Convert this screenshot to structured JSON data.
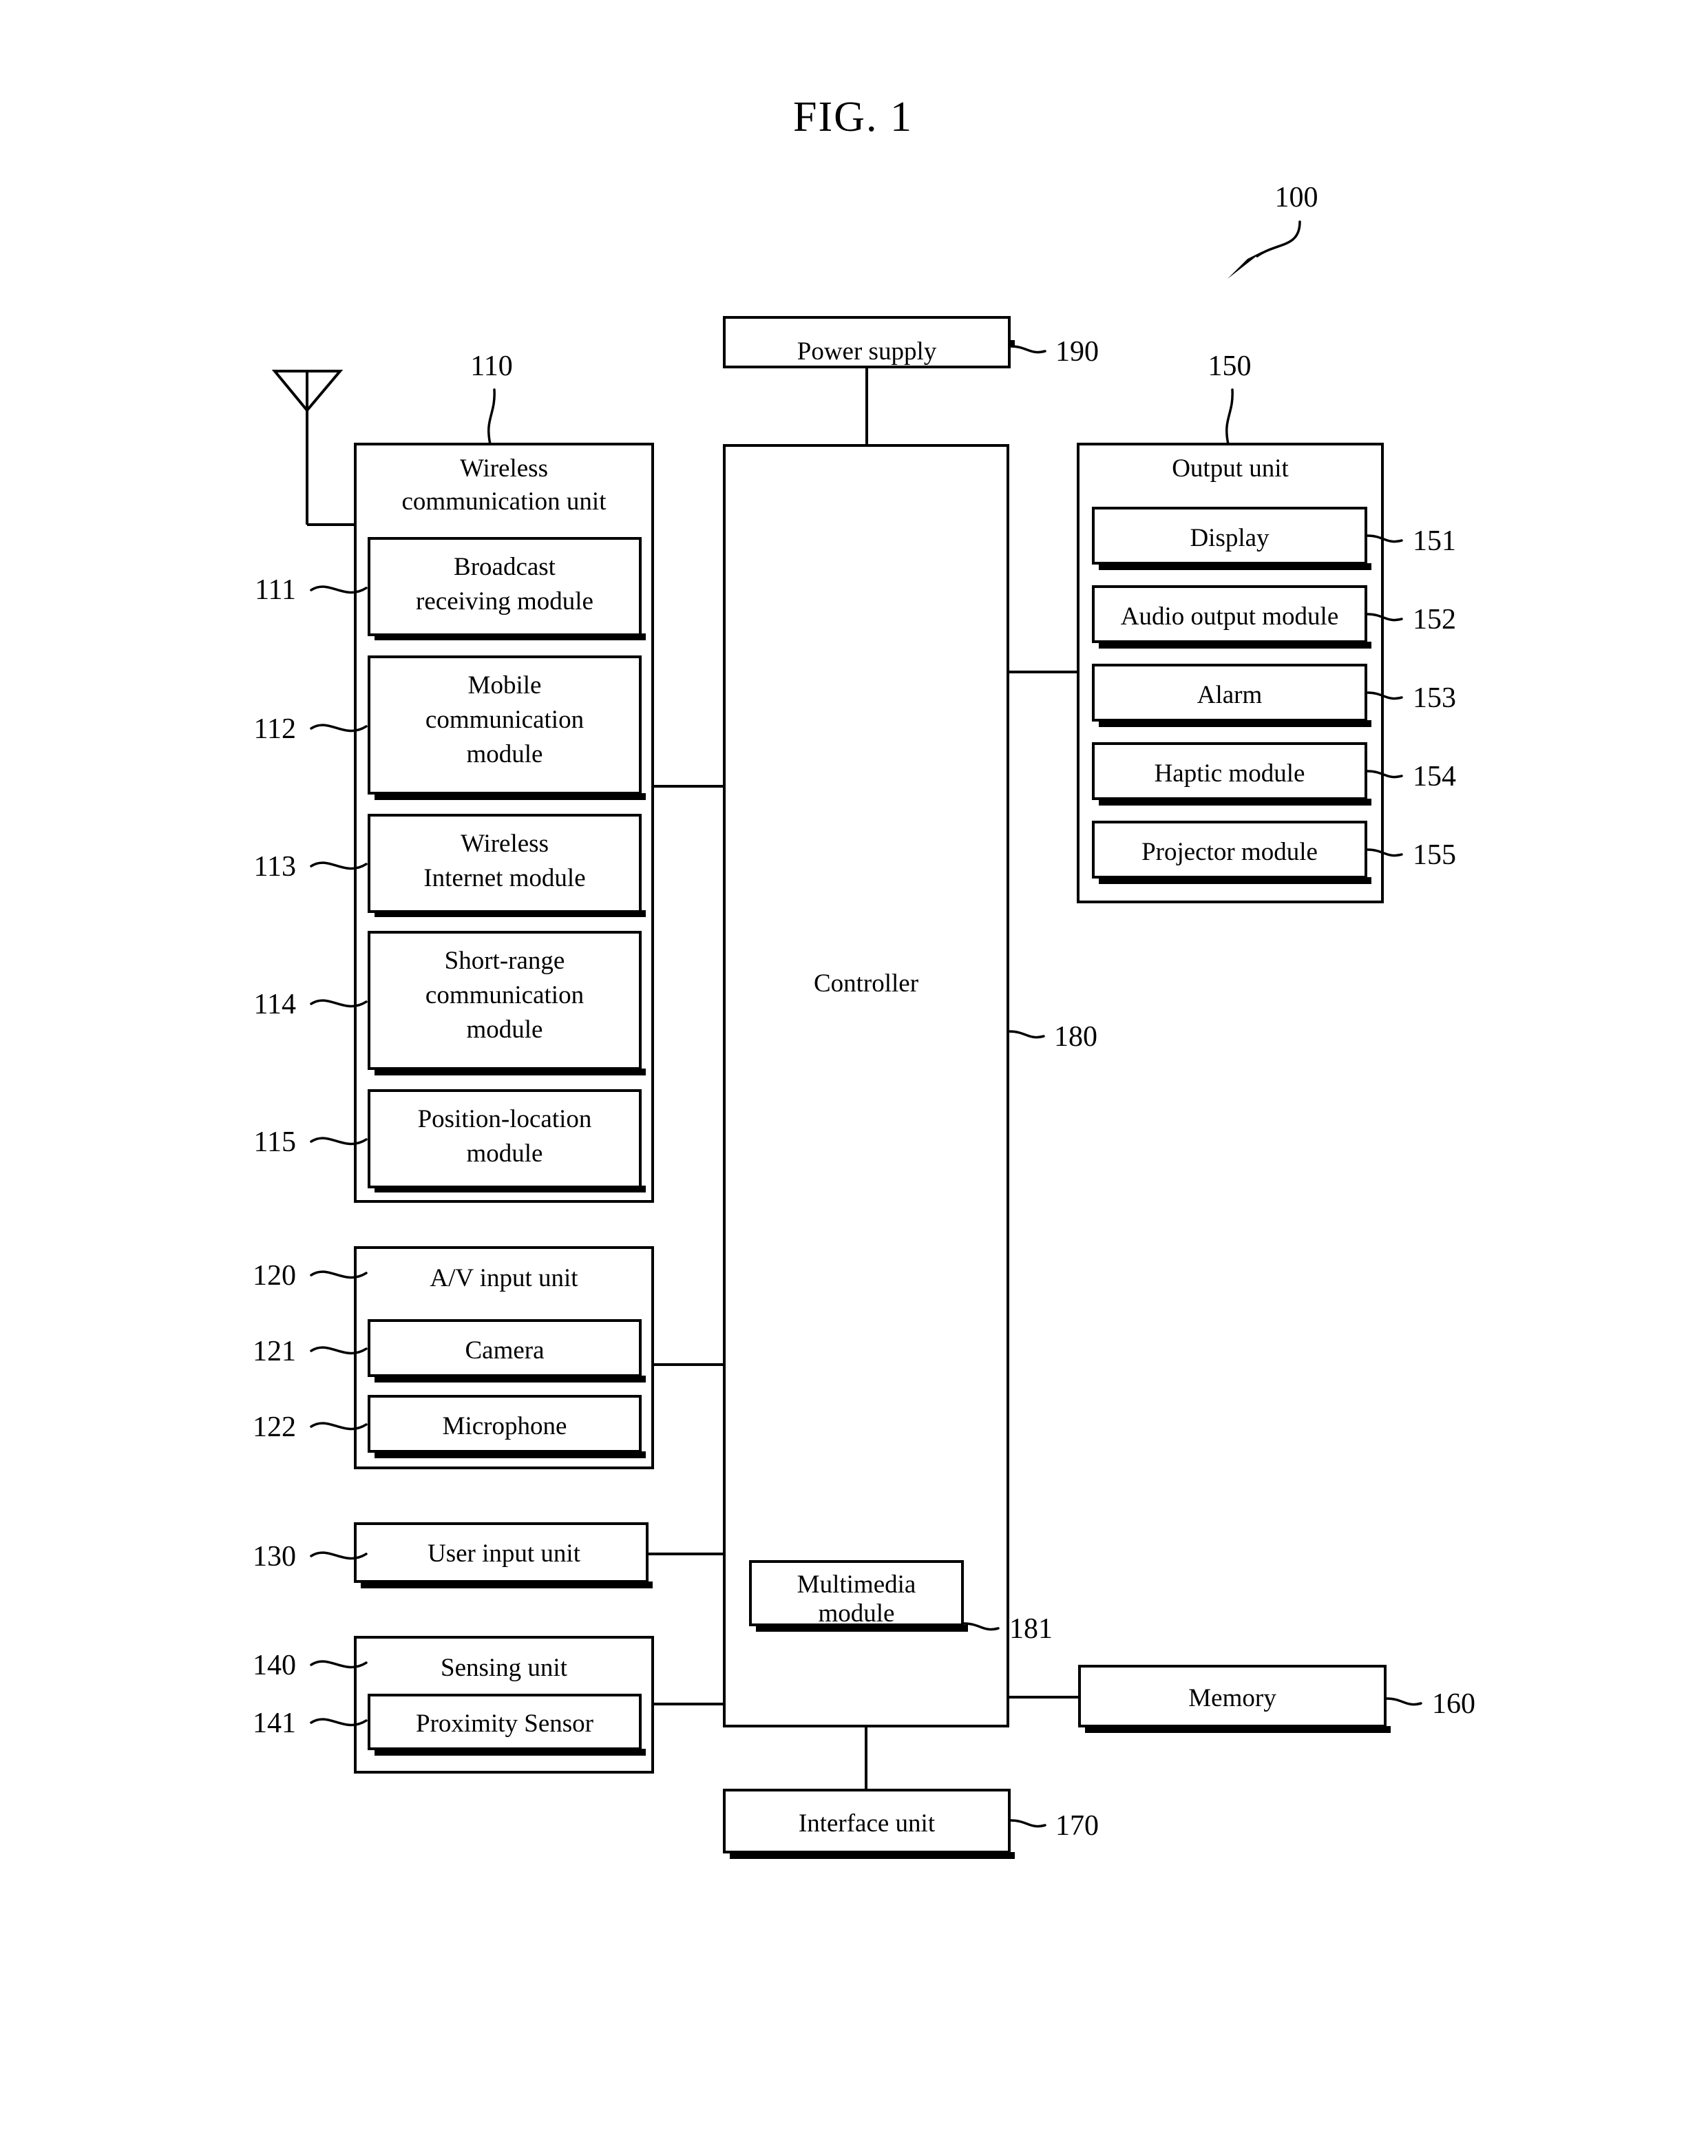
{
  "figure": {
    "title": "FIG. 1",
    "device_ref": "100"
  },
  "blocks": {
    "power_supply": {
      "label": "Power supply",
      "ref": "190"
    },
    "wireless_unit": {
      "label_line1": "Wireless",
      "label_line2": "communication unit",
      "ref": "110",
      "modules": [
        {
          "ref": "111",
          "lines": [
            "Broadcast",
            "receiving module"
          ]
        },
        {
          "ref": "112",
          "lines": [
            "Mobile",
            "communication",
            "module"
          ]
        },
        {
          "ref": "113",
          "lines": [
            "Wireless",
            "Internet module"
          ]
        },
        {
          "ref": "114",
          "lines": [
            "Short-range",
            "communication",
            "module"
          ]
        },
        {
          "ref": "115",
          "lines": [
            "Position-location",
            "module"
          ]
        }
      ]
    },
    "av_input_unit": {
      "label": "A/V input unit",
      "ref": "120",
      "modules": [
        {
          "ref": "121",
          "lines": [
            "Camera"
          ]
        },
        {
          "ref": "122",
          "lines": [
            "Microphone"
          ]
        }
      ]
    },
    "user_input_unit": {
      "label": "User input unit",
      "ref": "130"
    },
    "sensing_unit": {
      "label": "Sensing unit",
      "ref": "140",
      "modules": [
        {
          "ref": "141",
          "lines": [
            "Proximity Sensor"
          ]
        }
      ]
    },
    "controller": {
      "label": "Controller",
      "ref": "180",
      "sub_module": {
        "ref": "181",
        "lines": [
          "Multimedia",
          "module"
        ]
      }
    },
    "output_unit": {
      "label": "Output unit",
      "ref": "150",
      "modules": [
        {
          "ref": "151",
          "lines": [
            "Display"
          ]
        },
        {
          "ref": "152",
          "lines": [
            "Audio output module"
          ]
        },
        {
          "ref": "153",
          "lines": [
            "Alarm"
          ]
        },
        {
          "ref": "154",
          "lines": [
            "Haptic module"
          ]
        },
        {
          "ref": "155",
          "lines": [
            "Projector module"
          ]
        }
      ]
    },
    "memory": {
      "label": "Memory",
      "ref": "160"
    },
    "interface_unit": {
      "label": "Interface unit",
      "ref": "170"
    }
  },
  "icons": {
    "antenna": "antenna-icon",
    "pointer_arrow": "arrow-icon"
  },
  "colors": {
    "ink": "#000000",
    "paper": "#ffffff"
  }
}
